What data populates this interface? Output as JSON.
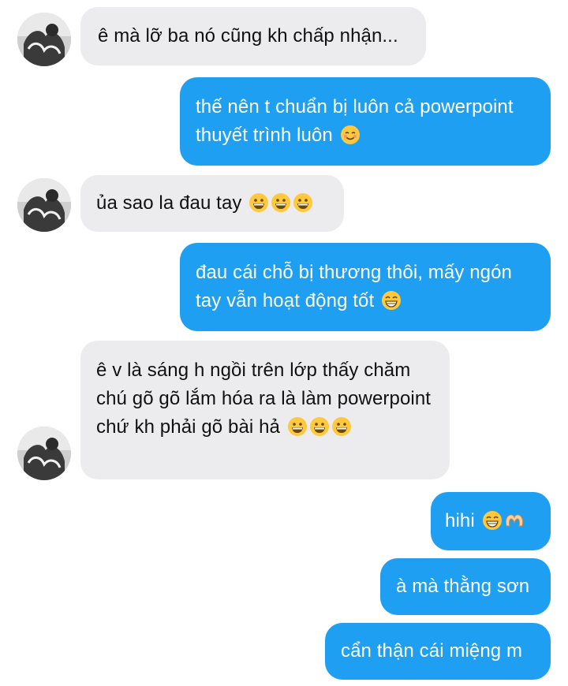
{
  "messages": [
    {
      "side": "in",
      "text": "ê mà lỡ ba nó cũng kh chấp nhận...",
      "emojis": []
    },
    {
      "side": "out",
      "text": "thế nên t chuẩn bị luôn cả powerpoint thuyết trình luôn",
      "emojis": [
        "smiling-blush-emoji"
      ]
    },
    {
      "side": "in",
      "text": "ủa sao la đau tay",
      "emojis": [
        "grinning-emoji",
        "grinning-emoji",
        "grinning-emoji"
      ]
    },
    {
      "side": "out",
      "text": "đau cái chỗ bị thương thôi, mấy ngón tay vẫn hoạt động tốt",
      "emojis": [
        "beaming-emoji"
      ]
    },
    {
      "side": "in",
      "text": "ê v là sáng h ngồi trên lớp thấy chăm chú gõ gõ lắm hóa ra là làm powerpoint chứ kh phải gõ bài hả",
      "emojis": [
        "grinning-emoji",
        "grinning-emoji",
        "grinning-emoji"
      ]
    },
    {
      "side": "out",
      "text": "hihi",
      "emojis": [
        "beaming-emoji",
        "heart-hands-emoji"
      ]
    },
    {
      "side": "out",
      "text": "à mà thằng sơn",
      "emojis": []
    },
    {
      "side": "out",
      "text": "cẩn thận cái miệng m",
      "emojis": []
    }
  ],
  "colors": {
    "incoming_bubble": "#ececef",
    "outgoing_bubble": "#1e9ff2",
    "incoming_text": "#111111",
    "outgoing_text": "#ffffff"
  }
}
